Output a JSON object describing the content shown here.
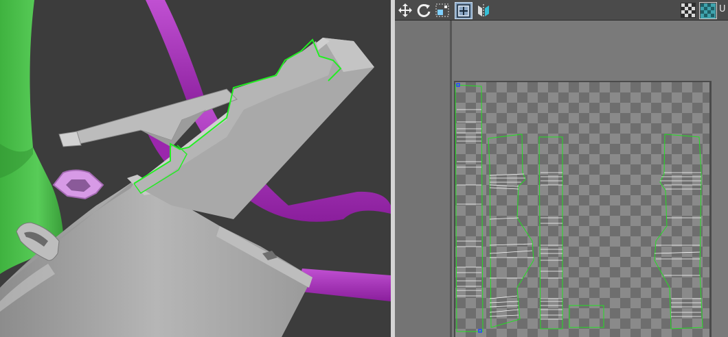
{
  "uv_toolbar": {
    "tools": [
      {
        "icon": "move-icon"
      },
      {
        "icon": "rotate-icon"
      },
      {
        "icon": "scale-selection-icon"
      },
      {
        "icon": "freeform-icon"
      },
      {
        "icon": "mirror-icon"
      }
    ],
    "right_tools": [
      {
        "icon": "checker-pattern-icon"
      },
      {
        "icon": "checker-texture-icon"
      }
    ],
    "truncated_label": "U"
  },
  "colors": {
    "viewport_bg": "#3c3c3c",
    "mesh_gray": "#a8a8a8",
    "selection_green": "#2ecc2e",
    "purple_tubes": "#a32ab7",
    "light_purple": "#d08ae0",
    "green_object": "#4ec24e",
    "uv_edge_white": "#ffffff",
    "uv_selected_vertex": "#2244ff"
  }
}
